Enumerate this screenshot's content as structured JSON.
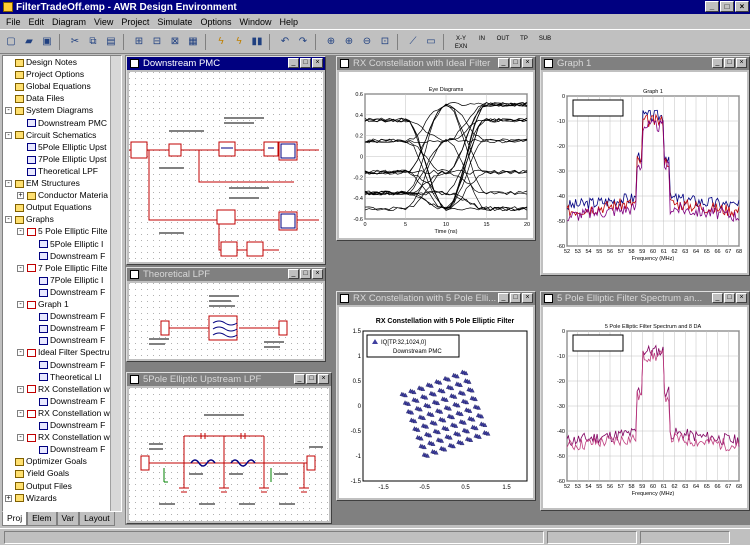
{
  "app": {
    "title": "FilterTradeOff.emp - AWR Design Environment"
  },
  "menu": [
    "File",
    "Edit",
    "Diagram",
    "View",
    "Project",
    "Simulate",
    "Options",
    "Window",
    "Help"
  ],
  "toolbar_text": [
    "X-Y EXN",
    "IN",
    "OUT",
    "TP",
    "SUB"
  ],
  "tree": [
    {
      "label": "Design Notes",
      "lvl": 1,
      "t": "y"
    },
    {
      "label": "Project Options",
      "lvl": 1,
      "t": "y"
    },
    {
      "label": "Global Equations",
      "lvl": 1,
      "t": "y"
    },
    {
      "label": "Data Files",
      "lvl": 1,
      "t": "y"
    },
    {
      "label": "System Diagrams",
      "lvl": 1,
      "t": "y",
      "e": "-"
    },
    {
      "label": "Downstream PMC",
      "lvl": 2,
      "t": "b"
    },
    {
      "label": "Circuit Schematics",
      "lvl": 1,
      "t": "y",
      "e": "-"
    },
    {
      "label": "5Pole Elliptic Upst",
      "lvl": 2,
      "t": "b"
    },
    {
      "label": "7Pole Elliptic Upst",
      "lvl": 2,
      "t": "b"
    },
    {
      "label": "Theoretical LPF",
      "lvl": 2,
      "t": "b"
    },
    {
      "label": "EM Structures",
      "lvl": 1,
      "t": "y",
      "e": "-"
    },
    {
      "label": "Conductor Materia",
      "lvl": 2,
      "t": "y",
      "e": "+"
    },
    {
      "label": "Output Equations",
      "lvl": 1,
      "t": "y"
    },
    {
      "label": "Graphs",
      "lvl": 1,
      "t": "y",
      "e": "-"
    },
    {
      "label": "5 Pole Elliptic Filte",
      "lvl": 2,
      "t": "g",
      "e": "-"
    },
    {
      "label": "5Pole Elliptic I",
      "lvl": 3,
      "t": "b"
    },
    {
      "label": "Downstream F",
      "lvl": 3,
      "t": "b"
    },
    {
      "label": "7 Pole Elliptic Filte",
      "lvl": 2,
      "t": "g",
      "e": "-"
    },
    {
      "label": "7Pole Elliptic I",
      "lvl": 3,
      "t": "b"
    },
    {
      "label": "Downstream F",
      "lvl": 3,
      "t": "b"
    },
    {
      "label": "Graph 1",
      "lvl": 2,
      "t": "g",
      "e": "-"
    },
    {
      "label": "Downstream F",
      "lvl": 3,
      "t": "b"
    },
    {
      "label": "Downstream F",
      "lvl": 3,
      "t": "b"
    },
    {
      "label": "Downstream F",
      "lvl": 3,
      "t": "b"
    },
    {
      "label": "Ideal Filter Spectru",
      "lvl": 2,
      "t": "g",
      "e": "-"
    },
    {
      "label": "Downstream F",
      "lvl": 3,
      "t": "b"
    },
    {
      "label": "Theoretical LI",
      "lvl": 3,
      "t": "b"
    },
    {
      "label": "RX Constellation w",
      "lvl": 2,
      "t": "g",
      "e": "-"
    },
    {
      "label": "Downstream F",
      "lvl": 3,
      "t": "b"
    },
    {
      "label": "RX Constellation w",
      "lvl": 2,
      "t": "g",
      "e": "-"
    },
    {
      "label": "Downstream F",
      "lvl": 3,
      "t": "b"
    },
    {
      "label": "RX Constellation w",
      "lvl": 2,
      "t": "g",
      "e": "-"
    },
    {
      "label": "Downstream F",
      "lvl": 3,
      "t": "b"
    },
    {
      "label": "Optimizer Goals",
      "lvl": 1,
      "t": "y"
    },
    {
      "label": "Yield Goals",
      "lvl": 1,
      "t": "y"
    },
    {
      "label": "Output Files",
      "lvl": 1,
      "t": "y"
    },
    {
      "label": "Wizards",
      "lvl": 1,
      "t": "y",
      "e": "+"
    }
  ],
  "tabs": [
    "Proj",
    "Elem",
    "Var",
    "Layout"
  ],
  "windows": {
    "pmc": {
      "title": "Downstream PMC"
    },
    "lpf": {
      "title": "Theoretical LPF"
    },
    "upstream": {
      "title": "5Pole Elliptic Upstream LPF"
    },
    "ideal": {
      "title": "RX Constellation with Ideal Filter"
    },
    "graph1": {
      "title": "Graph 1"
    },
    "rx5": {
      "title": "RX Constellation with 5 Pole Elli..."
    },
    "spec5": {
      "title": "5 Pole Elliptic Filter Spectrum an..."
    }
  },
  "chart_data": [
    {
      "type": "line",
      "title": "Eye Diagrams",
      "xlabel": "Time (ns)",
      "ylabel": "",
      "x_ticks": [
        "0",
        "5",
        "10",
        "15",
        "20"
      ],
      "y_ticks": [
        "0.6",
        "0.4",
        "0.2",
        "0",
        "-0.2",
        "-0.4",
        "-0.6"
      ],
      "xlim": [
        0,
        20
      ],
      "ylim": [
        -0.6,
        0.6
      ],
      "grid": true
    },
    {
      "type": "line",
      "title": "Graph 1",
      "xlabel": "Frequency (MHz)",
      "x_ticks": [
        "52",
        "53",
        "54",
        "55",
        "56",
        "57",
        "58",
        "59",
        "60",
        "61",
        "62",
        "63",
        "64",
        "65",
        "66",
        "67",
        "68"
      ],
      "y_ticks": [
        "0",
        "-10",
        "-20",
        "-30",
        "-40",
        "-50",
        "-60"
      ],
      "xlim": [
        52,
        68
      ],
      "ylim": [
        -60,
        0
      ],
      "grid": true
    },
    {
      "type": "scatter",
      "title": "RX Constellation with 5 Pole Elliptic Filter",
      "legend": [
        "IQ[TP.32,1024,0]",
        "Downstream PMC"
      ],
      "legend_position": "top-left",
      "x_ticks": [
        "-1.5",
        "-0.5",
        "0.5",
        "1.5"
      ],
      "y_ticks": [
        "1.5",
        "1",
        "0.5",
        "0",
        "-0.5",
        "-1",
        "-1.5"
      ],
      "xlim": [
        -1.5,
        1.5
      ],
      "ylim": [
        -1.5,
        1.5
      ],
      "grid": false
    },
    {
      "type": "line",
      "title": "5 Pole Elliptic Filter Spectrum and 8 DA",
      "xlabel": "Frequency (MHz)",
      "x_ticks": [
        "52",
        "53",
        "54",
        "55",
        "56",
        "57",
        "58",
        "59",
        "60",
        "61",
        "62",
        "63",
        "64",
        "65",
        "66",
        "67",
        "68"
      ],
      "y_ticks": [
        "0",
        "-10",
        "-20",
        "-30",
        "-40",
        "-50",
        "-60"
      ],
      "xlim": [
        52,
        68
      ],
      "ylim": [
        -60,
        0
      ],
      "grid": true
    }
  ]
}
